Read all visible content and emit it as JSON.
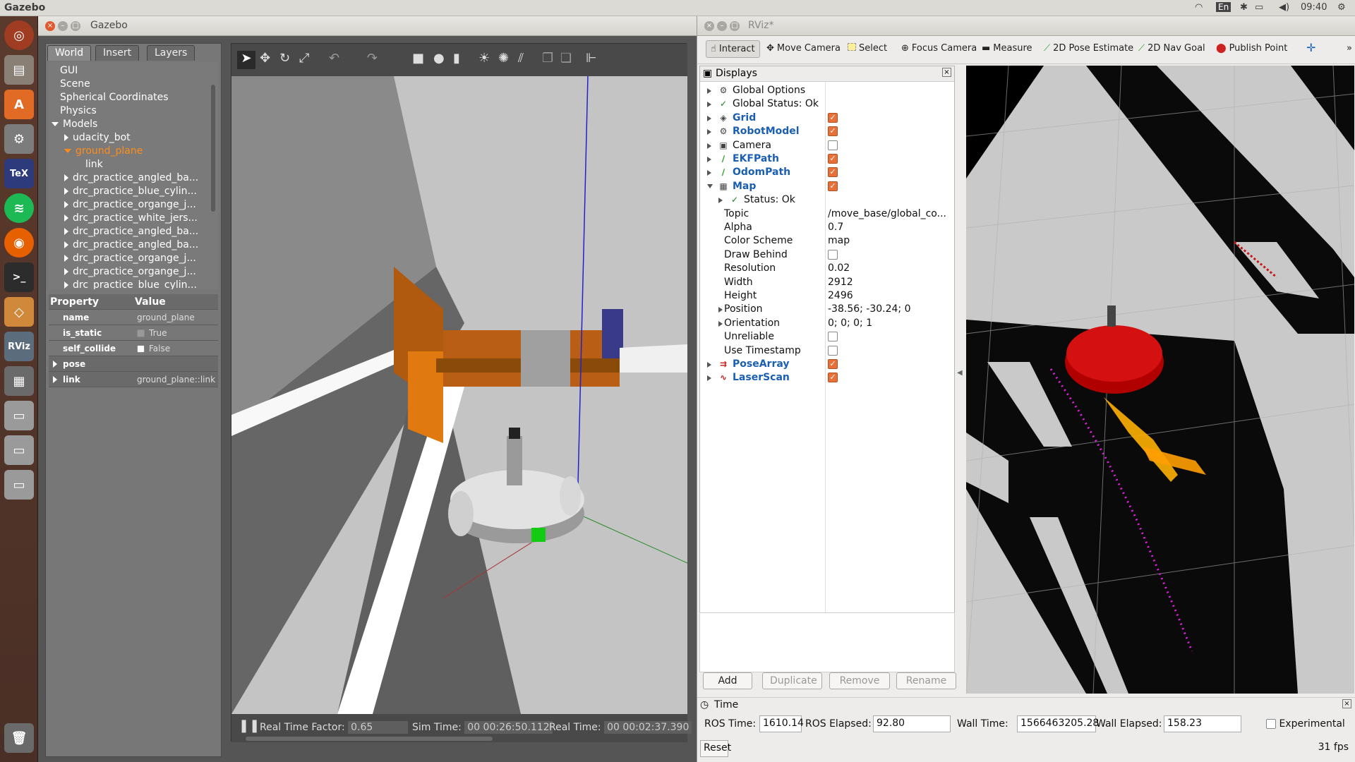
{
  "topbar": {
    "app_name": "Gazebo",
    "keyboard": "En",
    "time": "09:40"
  },
  "launcher": {
    "items": [
      "ubuntu-dash-icon",
      "files-icon",
      "software-center-icon",
      "settings-icon",
      "texmaker-icon",
      "spotify-icon",
      "firefox-icon",
      "terminal-icon",
      "gazebo-launcher-icon",
      "rviz-launcher-icon",
      "workspace-icon",
      "drive-icon",
      "drive-icon",
      "drive-icon",
      "trash-icon"
    ],
    "rviz_label": "RViz"
  },
  "gazebo": {
    "title": "Gazebo",
    "tabs": [
      "World",
      "Insert",
      "Layers"
    ],
    "tree": [
      {
        "label": "GUI",
        "indent": 0,
        "arrow": "none"
      },
      {
        "label": "Scene",
        "indent": 0,
        "arrow": "none"
      },
      {
        "label": "Spherical Coordinates",
        "indent": 0,
        "arrow": "none"
      },
      {
        "label": "Physics",
        "indent": 0,
        "arrow": "none"
      },
      {
        "label": "Models",
        "indent": 0,
        "arrow": "down"
      },
      {
        "label": "udacity_bot",
        "indent": 1,
        "arrow": "right"
      },
      {
        "label": "ground_plane",
        "indent": 1,
        "arrow": "down",
        "selected": true
      },
      {
        "label": "link",
        "indent": 2,
        "arrow": "none"
      },
      {
        "label": "drc_practice_angled_ba...",
        "indent": 1,
        "arrow": "right"
      },
      {
        "label": "drc_practice_blue_cylin...",
        "indent": 1,
        "arrow": "right"
      },
      {
        "label": "drc_practice_organge_j...",
        "indent": 1,
        "arrow": "right"
      },
      {
        "label": "drc_practice_white_jers...",
        "indent": 1,
        "arrow": "right"
      },
      {
        "label": "drc_practice_angled_ba...",
        "indent": 1,
        "arrow": "right"
      },
      {
        "label": "drc_practice_angled_ba...",
        "indent": 1,
        "arrow": "right"
      },
      {
        "label": "drc_practice_organge_j...",
        "indent": 1,
        "arrow": "right"
      },
      {
        "label": "drc_practice_organge_j...",
        "indent": 1,
        "arrow": "right"
      },
      {
        "label": "drc_practice_blue_cylin...",
        "indent": 1,
        "arrow": "right"
      }
    ],
    "props_header": {
      "property": "Property",
      "value": "Value"
    },
    "props": [
      {
        "key": "name",
        "value": "ground_plane"
      },
      {
        "key": "is_static",
        "value": "True",
        "check": true
      },
      {
        "key": "self_collide",
        "value": "False",
        "check": false
      },
      {
        "key": "pose",
        "value": ""
      },
      {
        "key": "link",
        "value": "ground_plane::link"
      }
    ],
    "bottom": {
      "rtf_label": "Real Time Factor:",
      "rtf": "0.65",
      "sim_label": "Sim Time:",
      "sim": "00 00:26:50.112",
      "real_label": "Real Time:",
      "real": "00 00:02:37.390"
    }
  },
  "rviz": {
    "title": "RViz*",
    "tools": [
      "Interact",
      "Move Camera",
      "Select",
      "Focus Camera",
      "Measure",
      "2D Pose Estimate",
      "2D Nav Goal",
      "Publish Point"
    ],
    "displays_title": "Displays",
    "rows": [
      {
        "name": "Global Options",
        "value": "",
        "indent": 0,
        "arrow": "right",
        "icon": "gear-icon",
        "glyph": "⚙",
        "style": "plain"
      },
      {
        "name": "Global Status: Ok",
        "value": "",
        "indent": 0,
        "arrow": "right",
        "icon": "check-icon",
        "glyph": "✓",
        "style": "plain"
      },
      {
        "name": "Grid",
        "value": "",
        "indent": 0,
        "arrow": "right",
        "icon": "grid-icon",
        "glyph": "◈",
        "style": "blue",
        "check": true
      },
      {
        "name": "RobotModel",
        "value": "",
        "indent": 0,
        "arrow": "right",
        "icon": "robot-icon",
        "glyph": "⚙",
        "style": "blue",
        "check": true
      },
      {
        "name": "Camera",
        "value": "",
        "indent": 0,
        "arrow": "right",
        "icon": "camera-icon",
        "glyph": "▣",
        "style": "plain",
        "check": false
      },
      {
        "name": "EKFPath",
        "value": "",
        "indent": 0,
        "arrow": "right",
        "icon": "path-icon",
        "glyph": "∕",
        "style": "blue",
        "check": true
      },
      {
        "name": "OdomPath",
        "value": "",
        "indent": 0,
        "arrow": "right",
        "icon": "path-icon",
        "glyph": "∕",
        "style": "blue",
        "check": true
      },
      {
        "name": "Map",
        "value": "",
        "indent": 0,
        "arrow": "down",
        "icon": "map-icon",
        "glyph": "▦",
        "style": "blue",
        "check": true
      },
      {
        "name": "Status: Ok",
        "value": "",
        "indent": 1,
        "arrow": "right",
        "icon": "check-icon",
        "glyph": "✓",
        "style": "plain"
      },
      {
        "name": "Topic",
        "value": "/move_base/global_co...",
        "indent": 1,
        "arrow": "none",
        "style": "plain"
      },
      {
        "name": "Alpha",
        "value": "0.7",
        "indent": 1,
        "arrow": "none",
        "style": "plain"
      },
      {
        "name": "Color Scheme",
        "value": "map",
        "indent": 1,
        "arrow": "none",
        "style": "plain"
      },
      {
        "name": "Draw Behind",
        "value": "",
        "indent": 1,
        "arrow": "none",
        "style": "plain",
        "check": false
      },
      {
        "name": "Resolution",
        "value": "0.02",
        "indent": 1,
        "arrow": "none",
        "style": "plain"
      },
      {
        "name": "Width",
        "value": "2912",
        "indent": 1,
        "arrow": "none",
        "style": "plain"
      },
      {
        "name": "Height",
        "value": "2496",
        "indent": 1,
        "arrow": "none",
        "style": "plain"
      },
      {
        "name": "Position",
        "value": "-38.56; -30.24; 0",
        "indent": 1,
        "arrow": "right",
        "style": "plain"
      },
      {
        "name": "Orientation",
        "value": "0; 0; 0; 1",
        "indent": 1,
        "arrow": "right",
        "style": "plain"
      },
      {
        "name": "Unreliable",
        "value": "",
        "indent": 1,
        "arrow": "none",
        "style": "plain",
        "check": false
      },
      {
        "name": "Use Timestamp",
        "value": "",
        "indent": 1,
        "arrow": "none",
        "style": "plain",
        "check": false
      },
      {
        "name": "PoseArray",
        "value": "",
        "indent": 0,
        "arrow": "right",
        "icon": "posearray-icon",
        "glyph": "⇉",
        "style": "blue",
        "check": true
      },
      {
        "name": "LaserScan",
        "value": "",
        "indent": 0,
        "arrow": "right",
        "icon": "laserscan-icon",
        "glyph": "∿",
        "style": "blue",
        "check": true
      }
    ],
    "buttons": [
      "Add",
      "Duplicate",
      "Remove",
      "Rename"
    ],
    "time": {
      "title": "Time",
      "ros_time_label": "ROS Time:",
      "ros_time": "1610.14",
      "ros_elapsed_label": "ROS Elapsed:",
      "ros_elapsed": "92.80",
      "wall_time_label": "Wall Time:",
      "wall_time": "1566463205.28",
      "wall_elapsed_label": "Wall Elapsed:",
      "wall_elapsed": "158.23",
      "experimental": "Experimental",
      "reset": "Reset",
      "fps": "31 fps"
    }
  }
}
